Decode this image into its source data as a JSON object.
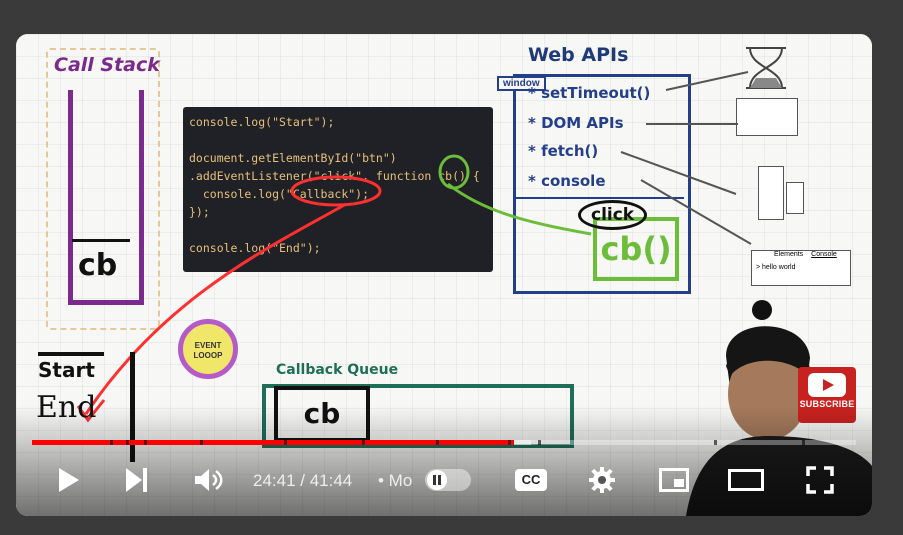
{
  "whiteboard": {
    "call_stack_title": "Call Stack",
    "call_stack_item": "cb",
    "code_lines": [
      "console.log(\"Start\");",
      "",
      "document.getElementById(\"btn\")",
      ".addEventListener(\"click\", function cb() {",
      "  console.log(\"Callback\");",
      "});",
      "",
      "console.log(\"End\");"
    ],
    "web_apis_title": "Web APIs",
    "window_label": "window",
    "web_api_items": [
      "* setTimeout()",
      "* DOM APIs",
      "* fetch()",
      "* console"
    ],
    "click_label": "click",
    "cb_label": "cb()",
    "event_loop_label": "EVENT LOOOP",
    "callback_queue_title": "Callback Queue",
    "callback_queue_item": "cb",
    "output_start": "Start",
    "output_end": "End",
    "console_sketch_text": "> hello world",
    "console_tab_labels": [
      "Elements",
      "Console"
    ]
  },
  "subscribe": {
    "label": "SUBSCRIBE"
  },
  "player": {
    "current_time": "24:41",
    "duration": "41:44",
    "time_display": "24:41 / 41:44",
    "chapter_text": "• Mo",
    "progress_played": 0.585,
    "progress_loaded": 0.605,
    "cc_label": "CC",
    "icons": [
      "play-icon",
      "next-icon",
      "volume-icon",
      "autoplay-pause-icon",
      "settings-gear-icon",
      "miniplayer-icon",
      "theater-mode-icon",
      "fullscreen-icon"
    ]
  },
  "colors": {
    "accent": "#ff0000",
    "stack": "#7c2a8e",
    "webapi": "#243f8a",
    "queue": "#1f6e58",
    "green": "#6cbd3a"
  }
}
